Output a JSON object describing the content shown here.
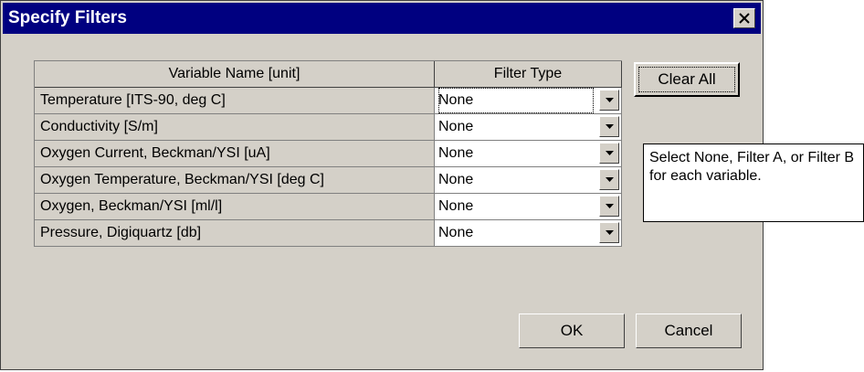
{
  "dialog": {
    "title": "Specify Filters",
    "close_icon": "close-x-icon"
  },
  "grid": {
    "headers": [
      "Variable Name [unit]",
      "Filter Type"
    ],
    "rows": [
      {
        "variable": "Temperature [ITS-90, deg C]",
        "filter": "None"
      },
      {
        "variable": "Conductivity [S/m]",
        "filter": "None"
      },
      {
        "variable": "Oxygen Current, Beckman/YSI [uA]",
        "filter": "None"
      },
      {
        "variable": "Oxygen Temperature, Beckman/YSI [deg C]",
        "filter": "None"
      },
      {
        "variable": "Oxygen, Beckman/YSI [ml/l]",
        "filter": "None"
      },
      {
        "variable": "Pressure, Digiquartz [db]",
        "filter": "None"
      }
    ],
    "dropdown_icon": "chevron-down-icon"
  },
  "buttons": {
    "clear_all": "Clear All",
    "ok": "OK",
    "cancel": "Cancel"
  },
  "callout": {
    "text": "Select None, Filter A, or Filter B for each variable."
  },
  "colors": {
    "titlebar": "#000080",
    "face": "#d4d0c8"
  }
}
